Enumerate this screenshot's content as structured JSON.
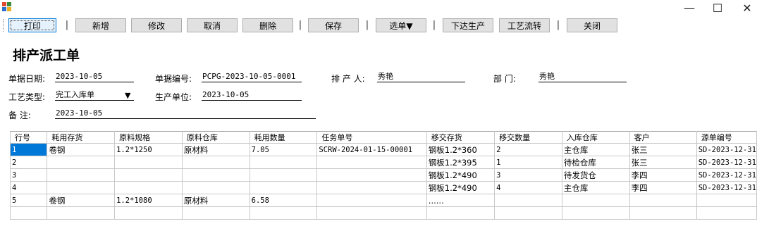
{
  "window": {
    "minimize": "—",
    "maximize": "☐",
    "close": "✕"
  },
  "toolbar": {
    "print": "打印",
    "new": "新增",
    "edit": "修改",
    "cancel": "取消",
    "delete": "删除",
    "save": "保存",
    "select": "选单▼",
    "issue": "下达生产",
    "process_flow": "工艺流转",
    "close": "关闭",
    "separator": "|"
  },
  "form": {
    "title": "排产派工单",
    "doc_date_label": "单据日期:",
    "doc_date": "2023-10-05",
    "doc_no_label": "单据编号:",
    "doc_no": "PCPG-2023-10-05-0001",
    "scheduler_label": "排 产 人:",
    "scheduler": "秀艳",
    "dept_label": "部    门:",
    "dept": "秀艳",
    "process_type_label": "工艺类型:",
    "process_type": "完工入库单",
    "unit_label": "生产单位:",
    "unit": "2023-10-05",
    "remark_label": "备    注:",
    "remark": "2023-10-05"
  },
  "grid": {
    "columns": [
      "行号",
      "耗用存货",
      "原料规格",
      "原料仓库",
      "耗用数量",
      "任务单号",
      "移交存货",
      "移交数量",
      "入库仓库",
      "客户",
      "源单编号"
    ],
    "rows": [
      [
        "1",
        "卷钢",
        "1.2*1250",
        "原材料",
        "7.05",
        "SCRW-2024-01-15-00001",
        "钢板1.2*360",
        "2",
        "主仓库",
        "张三",
        "SD-2023-12-31"
      ],
      [
        "2",
        "",
        "",
        "",
        "",
        "",
        "钢板1.2*395",
        "1",
        "待检仓库",
        "张三",
        "SD-2023-12-31"
      ],
      [
        "3",
        "",
        "",
        "",
        "",
        "",
        "钢板1.2*490",
        "3",
        "待发货仓",
        "李四",
        "SD-2023-12-31"
      ],
      [
        "4",
        "",
        "",
        "",
        "",
        "",
        "钢板1.2*490",
        "4",
        "主仓库",
        "李四",
        "SD-2023-12-31"
      ],
      [
        "5",
        "卷钢",
        "1.2*1080",
        "原材料",
        "6.58",
        "",
        "......",
        "",
        "",
        "",
        ""
      ],
      [
        "",
        "",
        "",
        "",
        "",
        "",
        "",
        "",
        "",
        "",
        ""
      ]
    ]
  }
}
